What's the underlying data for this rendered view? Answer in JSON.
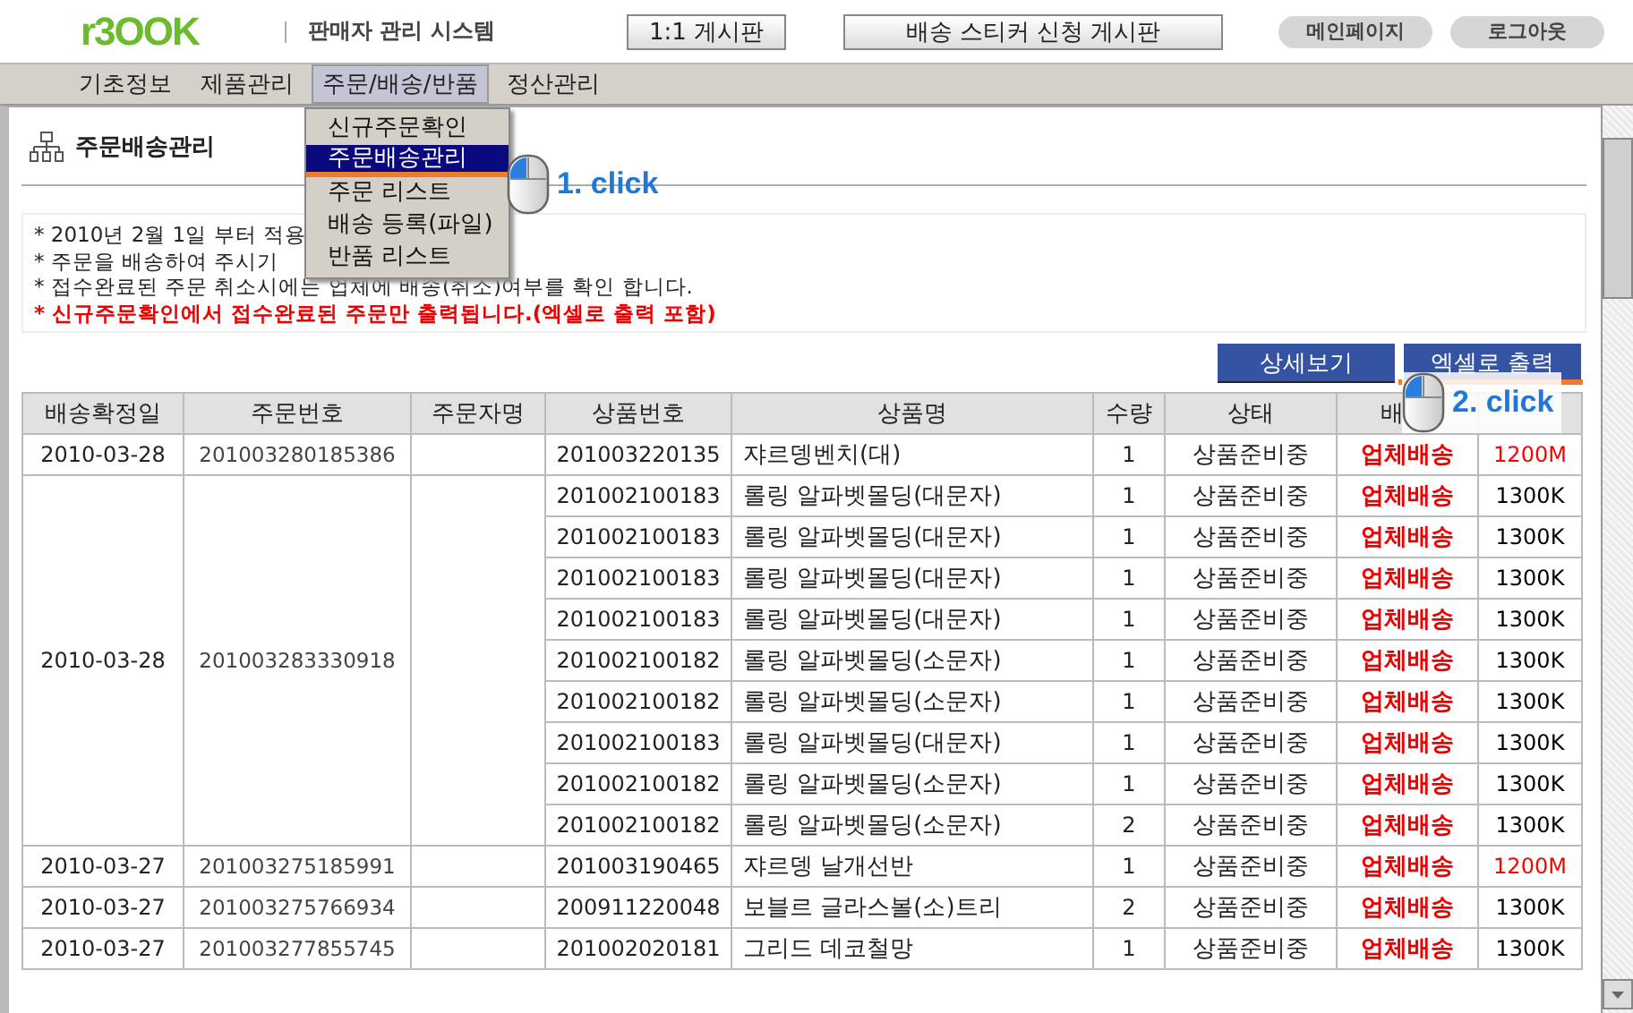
{
  "header": {
    "logo": "r3OOK",
    "title": "판매자 관리 시스템",
    "board_buttons": [
      "1:1 게시판",
      "배송 스티커 신청 게시판"
    ],
    "pill_buttons": [
      "메인페이지",
      "로그아웃"
    ]
  },
  "nav": [
    {
      "label": "기초정보",
      "selected": false
    },
    {
      "label": "제품관리",
      "selected": false
    },
    {
      "label": "주문/배송/반품",
      "selected": true
    },
    {
      "label": "정산관리",
      "selected": false
    }
  ],
  "dropdown": [
    {
      "label": "신규주문확인",
      "selected": false
    },
    {
      "label": "주문배송관리",
      "selected": true
    },
    {
      "label": "주문 리스트",
      "selected": false
    },
    {
      "label": "배송 등록(파일)",
      "selected": false
    },
    {
      "label": "반품 리스트",
      "selected": false
    }
  ],
  "page_title": "주문배송관리",
  "notes": [
    {
      "text": "* 2010년 2월 1일 부터 적용",
      "important": false
    },
    {
      "text": "* 주문을 배송하여 주시기",
      "important": false
    },
    {
      "text": "* 접수완료된 주문 취소시에는 업체에 배송(취소)여부를 확인 합니다.",
      "important": false
    },
    {
      "text": "* 신규주문확인에서 접수완료된 주문만 출력됩니다.(엑셀로 출력 포함)",
      "important": true
    }
  ],
  "actions": [
    "상세보기",
    "엑셀로 출력"
  ],
  "annotations": [
    "1. click",
    "2. click"
  ],
  "table": {
    "columns": [
      "배송확정일",
      "주문번호",
      "주문자명",
      "상품번호",
      "상품명",
      "수량",
      "상태",
      "배"
    ],
    "orders": [
      {
        "date": "2010-03-28",
        "order_no": "201003280185386",
        "items": [
          {
            "product_no": "201003220135",
            "name": "쟈르뎅벤치(대)",
            "qty": "1",
            "status": "상품준비중",
            "shipping": "업체배송",
            "code": "1200M",
            "color": "#ff0000"
          }
        ]
      },
      {
        "date": "2010-03-28",
        "order_no": "201003283330918",
        "items": [
          {
            "product_no": "201002100183",
            "name": "롤링 알파벳몰딩(대문자)",
            "qty": "1",
            "status": "상품준비중",
            "shipping": "업체배송",
            "code": "1300K",
            "color": "#000000"
          },
          {
            "product_no": "201002100183",
            "name": "롤링 알파벳몰딩(대문자)",
            "qty": "1",
            "status": "상품준비중",
            "shipping": "업체배송",
            "code": "1300K",
            "color": "#000000"
          },
          {
            "product_no": "201002100183",
            "name": "롤링 알파벳몰딩(대문자)",
            "qty": "1",
            "status": "상품준비중",
            "shipping": "업체배송",
            "code": "1300K",
            "color": "#000000"
          },
          {
            "product_no": "201002100183",
            "name": "롤링 알파벳몰딩(대문자)",
            "qty": "1",
            "status": "상품준비중",
            "shipping": "업체배송",
            "code": "1300K",
            "color": "#000000"
          },
          {
            "product_no": "201002100182",
            "name": "롤링 알파벳몰딩(소문자)",
            "qty": "1",
            "status": "상품준비중",
            "shipping": "업체배송",
            "code": "1300K",
            "color": "#000000"
          },
          {
            "product_no": "201002100182",
            "name": "롤링 알파벳몰딩(소문자)",
            "qty": "1",
            "status": "상품준비중",
            "shipping": "업체배송",
            "code": "1300K",
            "color": "#000000"
          },
          {
            "product_no": "201002100183",
            "name": "롤링 알파벳몰딩(대문자)",
            "qty": "1",
            "status": "상품준비중",
            "shipping": "업체배송",
            "code": "1300K",
            "color": "#000000"
          },
          {
            "product_no": "201002100182",
            "name": "롤링 알파벳몰딩(소문자)",
            "qty": "1",
            "status": "상품준비중",
            "shipping": "업체배송",
            "code": "1300K",
            "color": "#000000"
          },
          {
            "product_no": "201002100182",
            "name": "롤링 알파벳몰딩(소문자)",
            "qty": "2",
            "status": "상품준비중",
            "shipping": "업체배송",
            "code": "1300K",
            "color": "#000000"
          }
        ]
      },
      {
        "date": "2010-03-27",
        "order_no": "201003275185991",
        "items": [
          {
            "product_no": "201003190465",
            "name": "쟈르뎅 날개선반",
            "qty": "1",
            "status": "상품준비중",
            "shipping": "업체배송",
            "code": "1200M",
            "color": "#ff0000"
          }
        ]
      },
      {
        "date": "2010-03-27",
        "order_no": "201003275766934",
        "items": [
          {
            "product_no": "200911220048",
            "name": "보블르 글라스볼(소)트리",
            "qty": "2",
            "status": "상품준비중",
            "shipping": "업체배송",
            "code": "1300K",
            "color": "#000000"
          }
        ]
      },
      {
        "date": "2010-03-27",
        "order_no": "201003277855745",
        "items": [
          {
            "product_no": "201002020181",
            "name": "그리드 데코철망",
            "qty": "1",
            "status": "상품준비중",
            "shipping": "업체배송",
            "code": "1300K",
            "color": "#000000"
          }
        ]
      }
    ]
  }
}
